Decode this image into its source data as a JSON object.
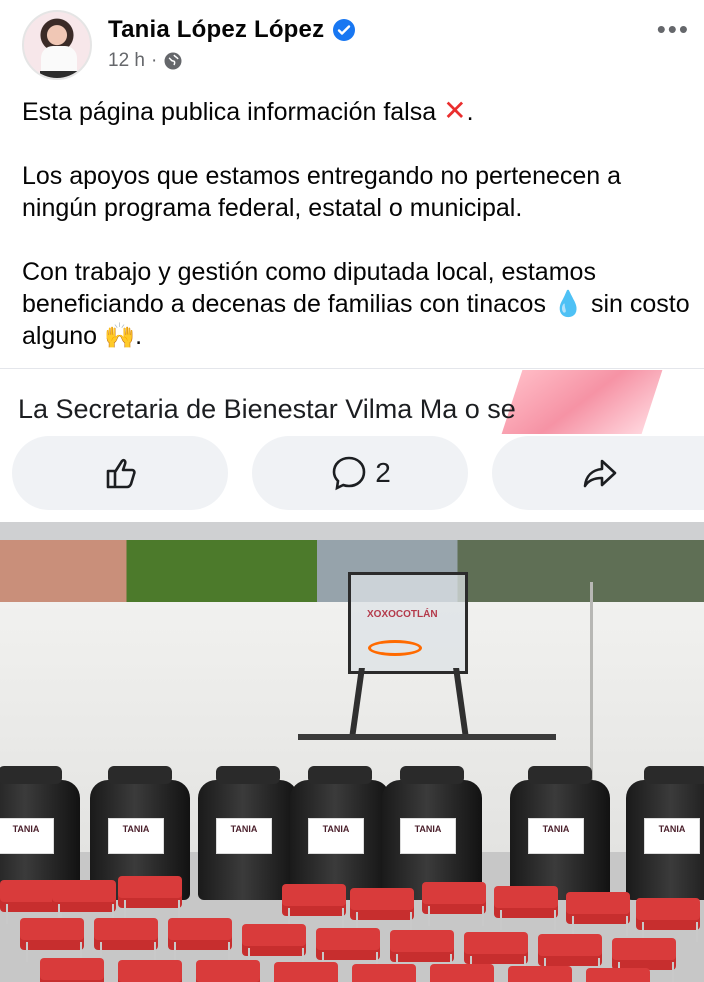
{
  "post": {
    "author": "Tania López López",
    "time": "12 h",
    "more_label": "•••",
    "paragraphs": [
      "Esta página publica información falsa",
      "Los apoyos que estamos entregando no pertenecen a ningún programa federal, estatal o municipal.",
      "Con trabajo y gestión como diputada local, estamos beneficiando a decenas de familias con tinacos 💧 sin costo alguno 🙌."
    ],
    "paragraph1_suffix": ".",
    "shared_preview_text": "La Secretaria de Bienestar Vilma Ma                          o se"
  },
  "actions": {
    "comment_count": "2"
  },
  "photo": {
    "backboard_text": "XOXOCOTLÁN",
    "tank_label": "TANIA"
  },
  "colors": {
    "accent": "#1877f2",
    "meta": "#65676b",
    "pill": "#f0f2f5"
  }
}
